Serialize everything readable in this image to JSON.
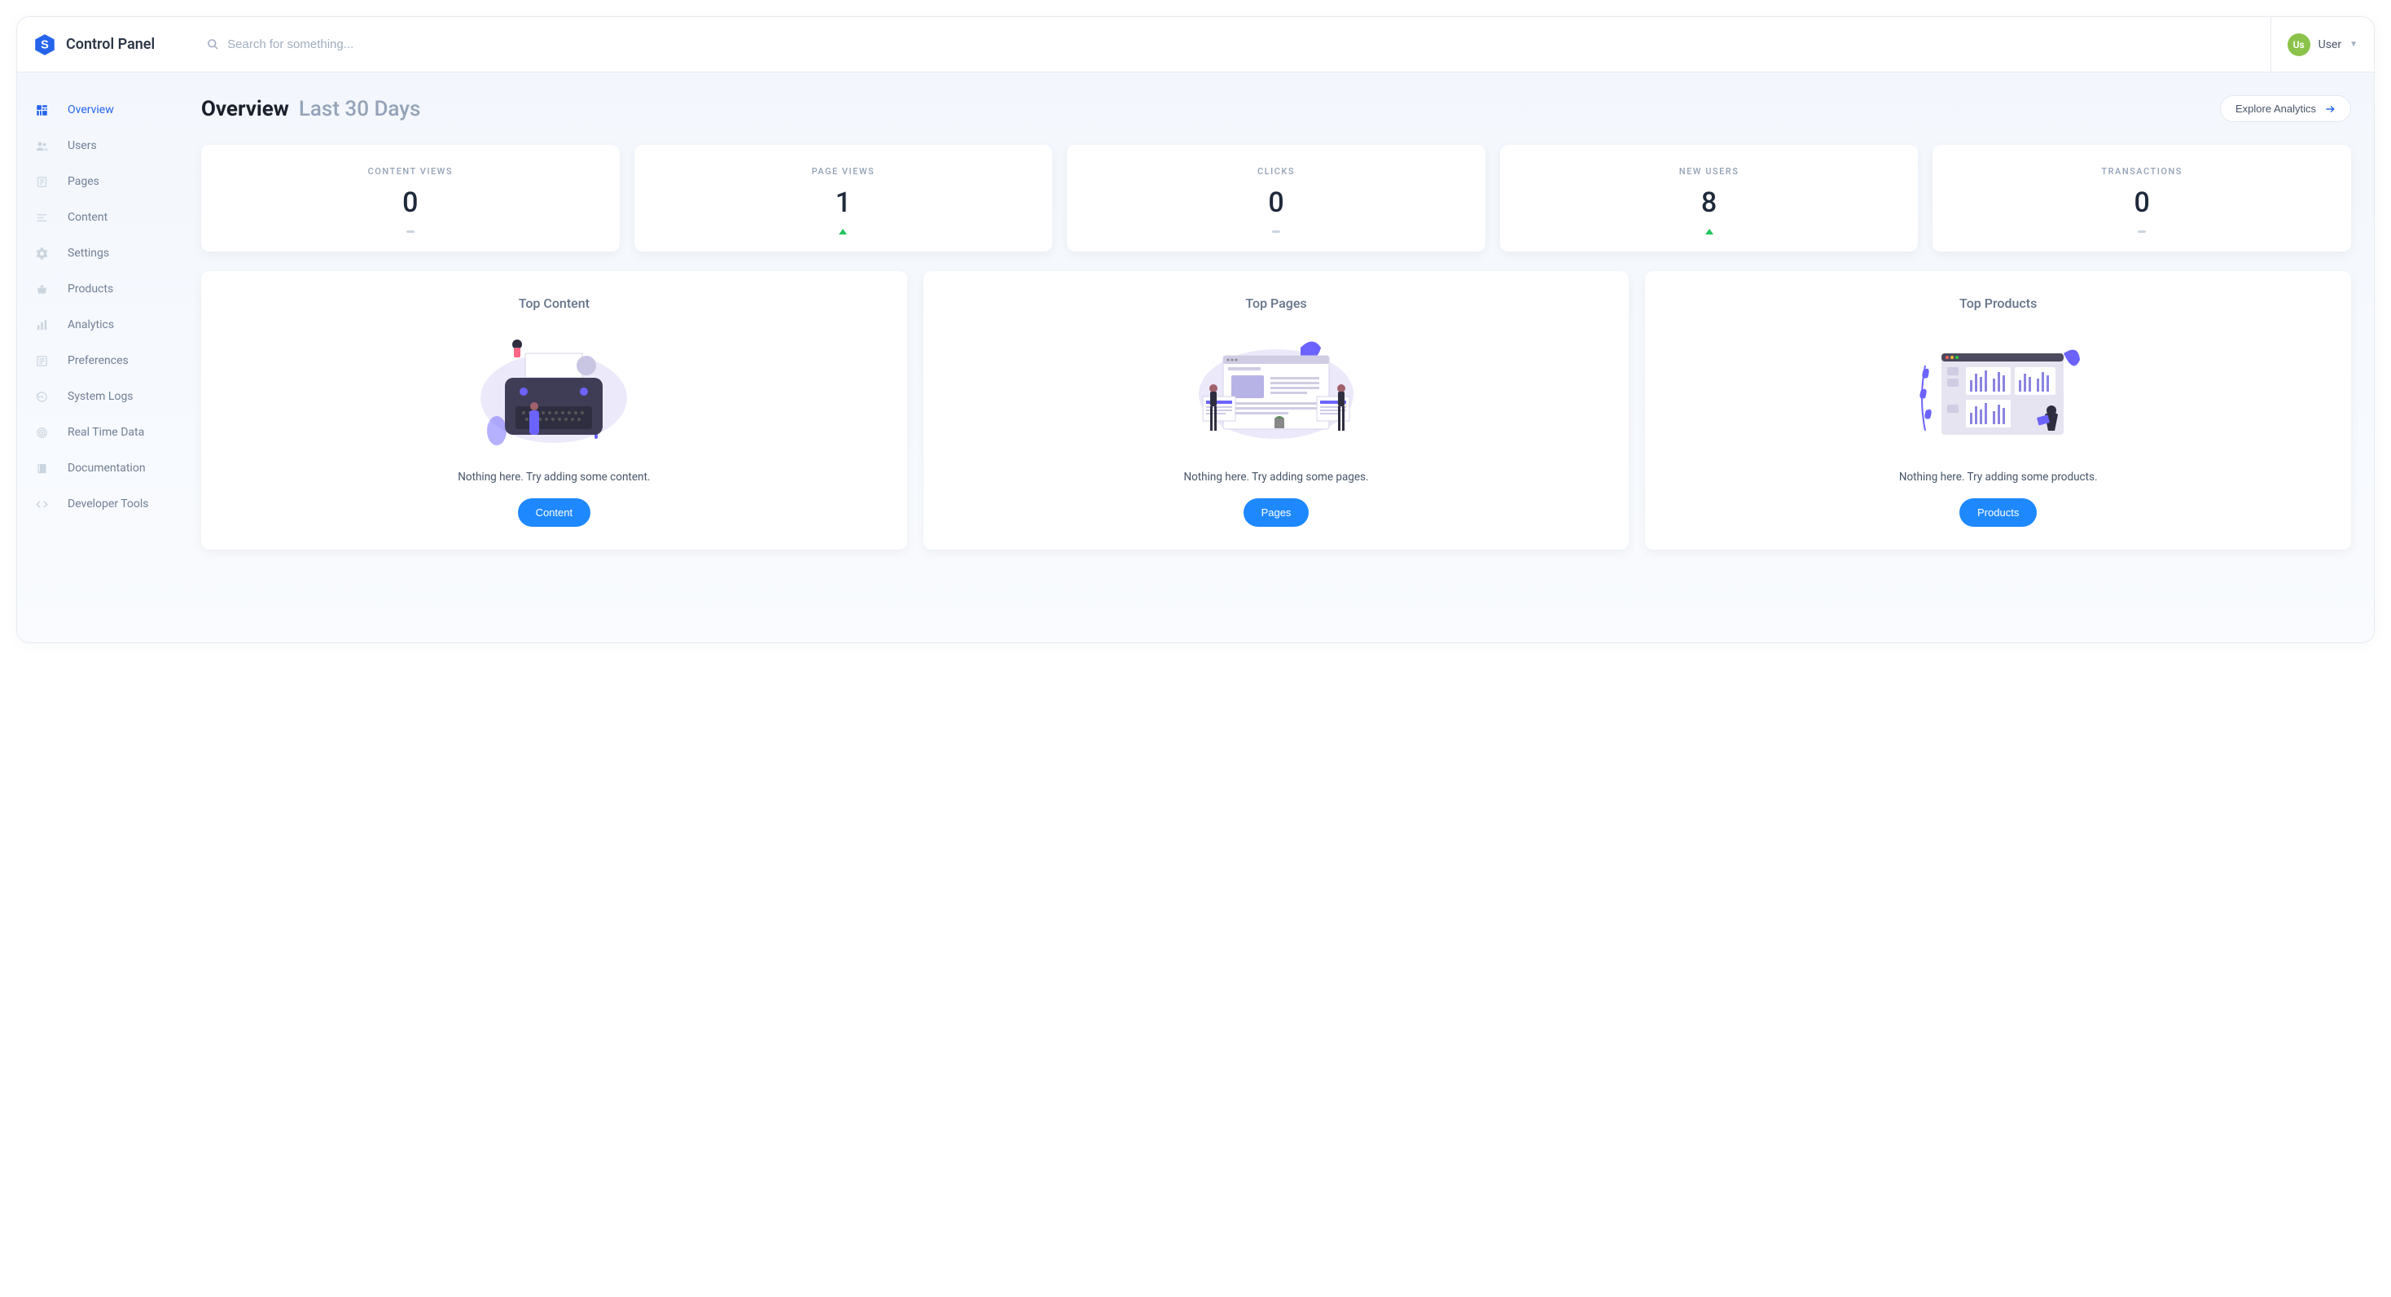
{
  "brand": {
    "title": "Control Panel"
  },
  "search": {
    "placeholder": "Search for something..."
  },
  "user": {
    "avatar_initials": "Us",
    "name": "User"
  },
  "sidebar": {
    "items": [
      {
        "label": "Overview",
        "icon": "dashboard-icon",
        "active": true
      },
      {
        "label": "Users",
        "icon": "users-icon"
      },
      {
        "label": "Pages",
        "icon": "pages-icon"
      },
      {
        "label": "Content",
        "icon": "content-icon"
      },
      {
        "label": "Settings",
        "icon": "gear-icon"
      },
      {
        "label": "Products",
        "icon": "basket-icon"
      },
      {
        "label": "Analytics",
        "icon": "bars-icon"
      },
      {
        "label": "Preferences",
        "icon": "list-icon"
      },
      {
        "label": "System Logs",
        "icon": "history-icon"
      },
      {
        "label": "Real Time Data",
        "icon": "target-icon"
      },
      {
        "label": "Documentation",
        "icon": "book-icon"
      },
      {
        "label": "Developer Tools",
        "icon": "code-icon"
      }
    ]
  },
  "page": {
    "title": "Overview",
    "subtitle": "Last 30 Days",
    "explore_label": "Explore Analytics"
  },
  "stats": [
    {
      "label": "CONTENT VIEWS",
      "value": "0",
      "trend": "flat"
    },
    {
      "label": "PAGE VIEWS",
      "value": "1",
      "trend": "up"
    },
    {
      "label": "CLICKS",
      "value": "0",
      "trend": "flat"
    },
    {
      "label": "NEW USERS",
      "value": "8",
      "trend": "up"
    },
    {
      "label": "TRANSACTIONS",
      "value": "0",
      "trend": "flat"
    }
  ],
  "panels": [
    {
      "title": "Top Content",
      "empty_text": "Nothing here. Try adding some content.",
      "button_label": "Content"
    },
    {
      "title": "Top Pages",
      "empty_text": "Nothing here. Try adding some pages.",
      "button_label": "Pages"
    },
    {
      "title": "Top Products",
      "empty_text": "Nothing here. Try adding some products.",
      "button_label": "Products"
    }
  ],
  "colors": {
    "accent": "#2563eb",
    "primary_btn": "#1e88ff",
    "avatar_bg": "#8bc34a",
    "trend_up": "#22c55e"
  }
}
